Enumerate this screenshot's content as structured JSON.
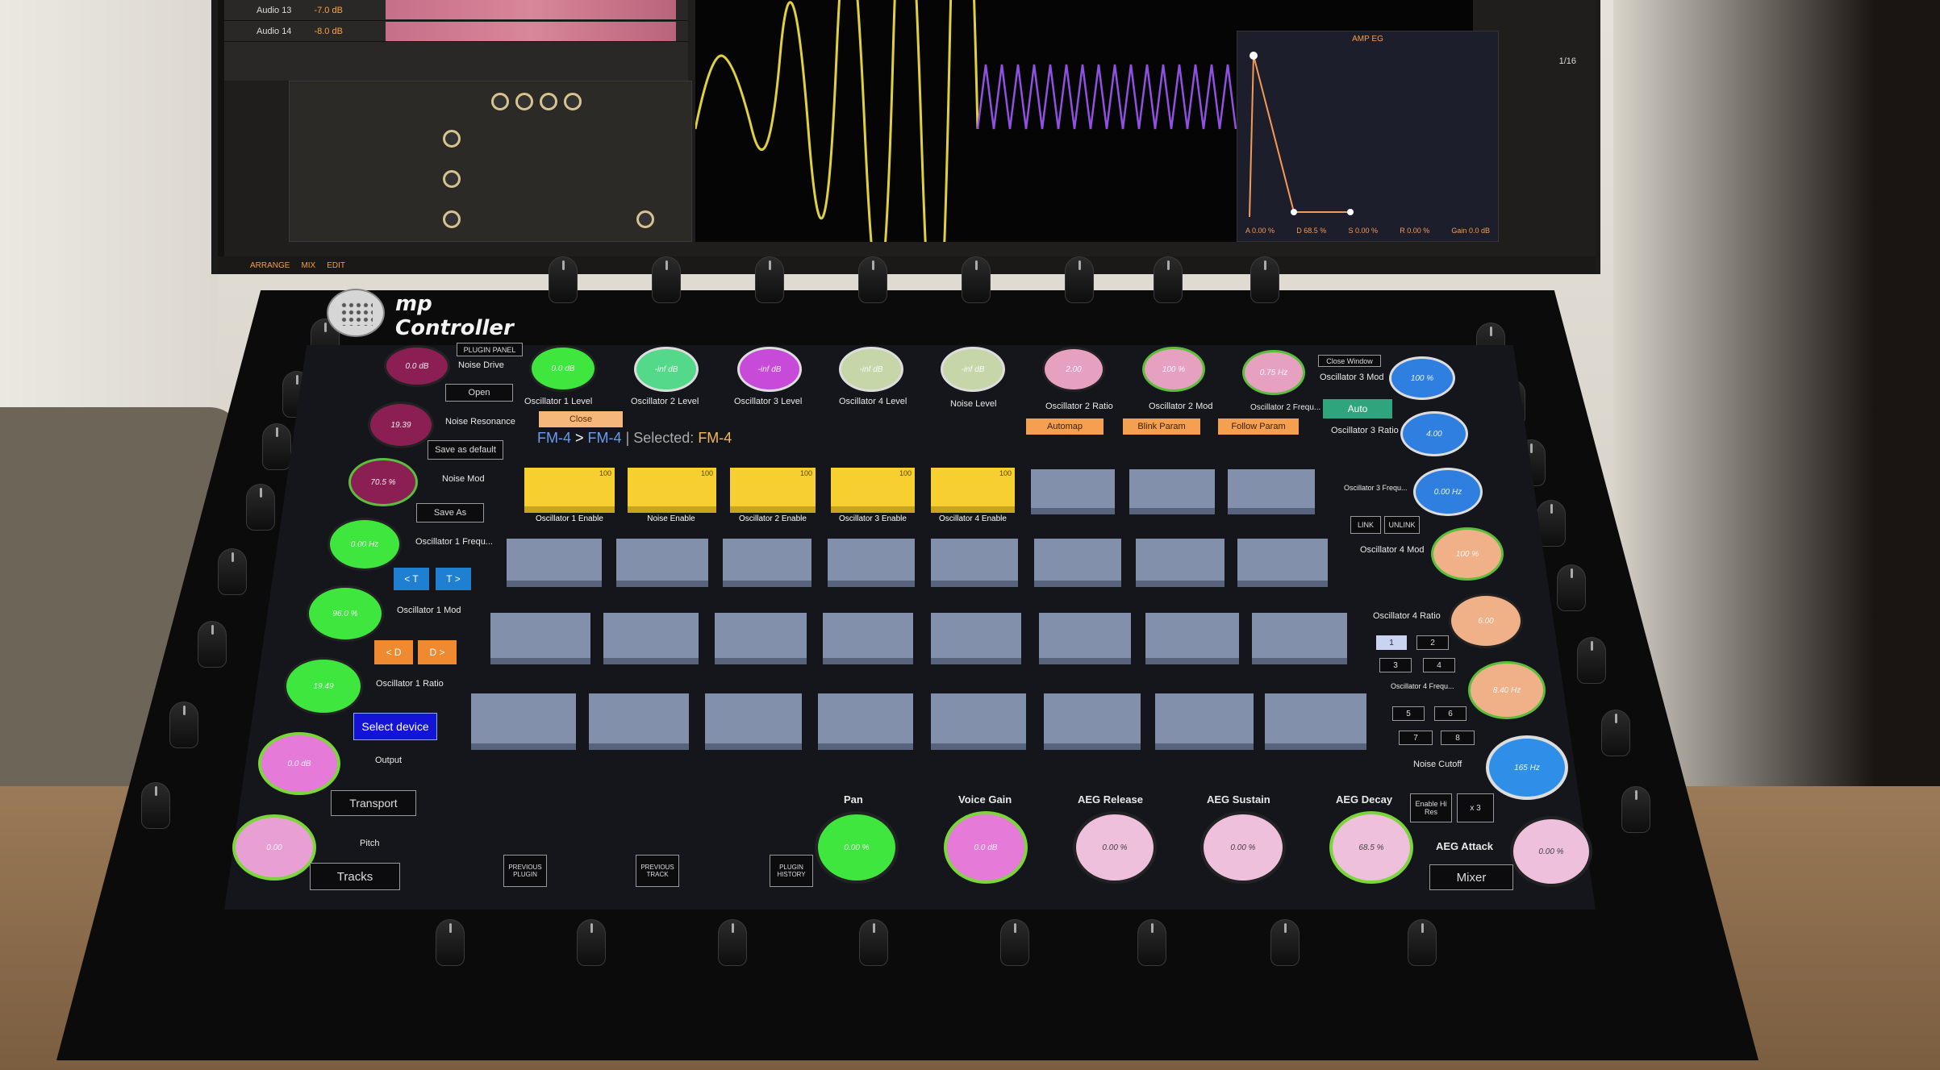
{
  "daw": {
    "tracks": [
      {
        "name": "Audio 13",
        "volume": "-7.0 dB"
      },
      {
        "name": "Audio 14",
        "volume": "-8.0 dB"
      }
    ],
    "bottom_tabs": [
      "ARRANGE",
      "MIX",
      "EDIT"
    ],
    "page_counter": "1/16",
    "amp_eg": {
      "title": "AMP EG",
      "params": [
        {
          "label": "A",
          "value": "0.00 %"
        },
        {
          "label": "D",
          "value": "68.5 %"
        },
        {
          "label": "S",
          "value": "0.00 %"
        },
        {
          "label": "R",
          "value": "0.00 %"
        }
      ],
      "gain_label": "Gain",
      "gain_value": "0.0 dB"
    }
  },
  "controller": {
    "logo_line1": "mp",
    "logo_line2": "Controller",
    "breadcrumb": {
      "device": "FM-4",
      "arrow": ">",
      "preset": "FM-4",
      "selected_label": "| Selected:",
      "selected_value": "FM-4"
    },
    "left_buttons": {
      "plugin_panel": "PLUGIN PANEL",
      "open": "Open",
      "close": "Close",
      "save_default": "Save as default",
      "save_as": "Save As",
      "track_prev": "< T",
      "track_next": "T >",
      "device_prev": "< D",
      "device_next": "D >",
      "select_device": "Select device",
      "transport": "Transport",
      "tracks": "Tracks"
    },
    "left_knobs": [
      {
        "label": "Noise Drive",
        "value": "0.0 dB",
        "color": "#8b1f54"
      },
      {
        "label": "Noise Resonance",
        "value": "19.39",
        "color": "#8b1f54"
      },
      {
        "label": "Noise Mod",
        "value": "70.5 %",
        "color": "#8b1f54"
      },
      {
        "label": "Oscillator 1 Frequ...",
        "value": "0.00 Hz",
        "color": "#3ee63e"
      },
      {
        "label": "Oscillator 1 Mod",
        "value": "96.0 %",
        "color": "#3ee63e"
      },
      {
        "label": "Oscillator 1 Ratio",
        "value": "19.49",
        "color": "#3ee63e"
      },
      {
        "label": "Output",
        "value": "0.0 dB",
        "color": "#e57ad9"
      },
      {
        "label": "Pitch",
        "value": "0.00",
        "color": "#e8a0d4"
      }
    ],
    "top_knobs": [
      {
        "label": "Oscillator 1 Level",
        "value": "0.0 dB",
        "color": "#3ee63e"
      },
      {
        "label": "Oscillator 2 Level",
        "value": "-inf dB",
        "color": "#54d88a"
      },
      {
        "label": "Oscillator 3 Level",
        "value": "-inf dB",
        "color": "#c84ad8"
      },
      {
        "label": "Oscillator 4 Level",
        "value": "-inf dB",
        "color": "#c6d6a8"
      },
      {
        "label": "Noise Level",
        "value": "-inf dB",
        "color": "#c6d6a8"
      },
      {
        "label": "Oscillator 2 Ratio",
        "value": "2.00",
        "color": "#e6a0c0"
      },
      {
        "label": "Oscillator 2 Mod",
        "value": "100 %",
        "color": "#e6a0c0"
      },
      {
        "label": "Oscillator 2 Frequ...",
        "value": "0.75 Hz",
        "color": "#e6a0c0"
      }
    ],
    "top_actions": {
      "automap": "Automap",
      "blink": "Blink Param",
      "follow": "Follow Param"
    },
    "pad_labels": [
      "Oscillator 1 Enable",
      "Noise Enable",
      "Oscillator 2 Enable",
      "Oscillator 3 Enable",
      "Oscillator 4 Enable"
    ],
    "pad_value": "100",
    "right_panel": {
      "close_window": "Close Window",
      "auto": "Auto",
      "link": "LINK",
      "unlink": "UNLINK",
      "enable_hi_res": "Enable Hi Res",
      "x3": "x 3",
      "mixer": "Mixer",
      "pages": [
        "1",
        "2",
        "3",
        "4",
        "5",
        "6",
        "7",
        "8"
      ]
    },
    "right_knobs": [
      {
        "label": "Oscillator 3 Mod",
        "value": "100 %",
        "color": "#2f7fe0"
      },
      {
        "label": "Oscillator 3 Ratio",
        "value": "4.00",
        "color": "#2f7fe0"
      },
      {
        "label": "Oscillator 3 Frequ...",
        "value": "0.00 Hz",
        "color": "#2f7fe0"
      },
      {
        "label": "Oscillator 4 Mod",
        "value": "100 %",
        "color": "#f0b088"
      },
      {
        "label": "Oscillator 4 Ratio",
        "value": "6.00",
        "color": "#f0b088"
      },
      {
        "label": "Oscillator 4 Frequ...",
        "value": "8.40 Hz",
        "color": "#f0b088"
      },
      {
        "label": "Noise Cutoff",
        "value": "165 Hz",
        "color": "#2f8fe8"
      }
    ],
    "bottom_nav": {
      "prev_plugin": "PREVIOUS PLUGIN",
      "prev_track": "PREVIOUS TRACK",
      "plugin_history": "PLUGIN HISTORY"
    },
    "bottom_knobs": [
      {
        "label": "Pan",
        "value": "0.00 %",
        "color": "#3ee63e"
      },
      {
        "label": "Voice Gain",
        "value": "0.0 dB",
        "color": "#e57ad9"
      },
      {
        "label": "AEG Release",
        "value": "0.00 %",
        "color": "#efc0dc"
      },
      {
        "label": "AEG Sustain",
        "value": "0.00 %",
        "color": "#efc0dc"
      },
      {
        "label": "AEG Decay",
        "value": "68.5 %",
        "color": "#efc0dc"
      },
      {
        "label": "AEG Attack",
        "value": "0.00 %",
        "color": "#efc0dc"
      }
    ]
  }
}
